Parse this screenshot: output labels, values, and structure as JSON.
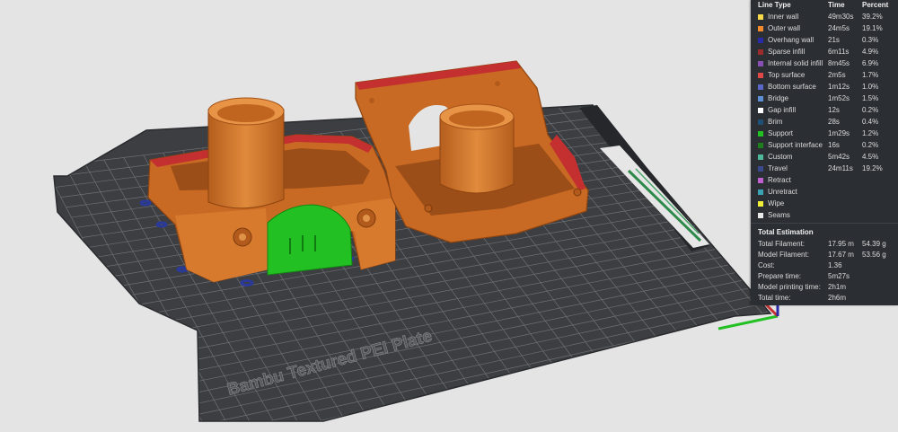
{
  "plate": {
    "label": "Bambu Textured PEI Plate"
  },
  "legend": {
    "headers": {
      "line_type": "Line Type",
      "time": "Time",
      "percent": "Percent"
    },
    "rows": [
      {
        "name": "Inner wall",
        "time": "49m30s",
        "percent": "39.2%",
        "color": "#f7d94a"
      },
      {
        "name": "Outer wall",
        "time": "24m5s",
        "percent": "19.1%",
        "color": "#f08a2c"
      },
      {
        "name": "Overhang wall",
        "time": "21s",
        "percent": "0.3%",
        "color": "#2a2aa8"
      },
      {
        "name": "Sparse infill",
        "time": "6m11s",
        "percent": "4.9%",
        "color": "#9c2b2b"
      },
      {
        "name": "Internal solid infill",
        "time": "8m45s",
        "percent": "6.9%",
        "color": "#8a4fb5"
      },
      {
        "name": "Top surface",
        "time": "2m5s",
        "percent": "1.7%",
        "color": "#e04848"
      },
      {
        "name": "Bottom surface",
        "time": "1m12s",
        "percent": "1.0%",
        "color": "#5a66c8"
      },
      {
        "name": "Bridge",
        "time": "1m52s",
        "percent": "1.5%",
        "color": "#5b8fd6"
      },
      {
        "name": "Gap infill",
        "time": "12s",
        "percent": "0.2%",
        "color": "#ffffff"
      },
      {
        "name": "Brim",
        "time": "28s",
        "percent": "0.4%",
        "color": "#1f4f74"
      },
      {
        "name": "Support",
        "time": "1m29s",
        "percent": "1.2%",
        "color": "#22c022"
      },
      {
        "name": "Support interface",
        "time": "16s",
        "percent": "0.2%",
        "color": "#1e7e1e"
      },
      {
        "name": "Custom",
        "time": "5m42s",
        "percent": "4.5%",
        "color": "#4fb89a"
      },
      {
        "name": "Travel",
        "time": "24m11s",
        "percent": "19.2%",
        "color": "#3a4a8c"
      },
      {
        "name": "Retract",
        "time": "",
        "percent": "",
        "color": "#c060d0"
      },
      {
        "name": "Unretract",
        "time": "",
        "percent": "",
        "color": "#3aa4b4"
      },
      {
        "name": "Wipe",
        "time": "",
        "percent": "",
        "color": "#f0f03a"
      },
      {
        "name": "Seams",
        "time": "",
        "percent": "",
        "color": "#e8e8e8"
      }
    ]
  },
  "estimation": {
    "title": "Total Estimation",
    "rows": [
      {
        "label": "Total Filament:",
        "v1": "17.95 m",
        "v2": "54.39 g"
      },
      {
        "label": "Model Filament:",
        "v1": "17.67 m",
        "v2": "53.56 g"
      },
      {
        "label": "Cost:",
        "v1": "1.36",
        "v2": ""
      },
      {
        "label": "Prepare time:",
        "v1": "5m27s",
        "v2": ""
      },
      {
        "label": "Model printing time:",
        "v1": "2h1m",
        "v2": ""
      },
      {
        "label": "Total time:",
        "v1": "2h6m",
        "v2": ""
      }
    ]
  },
  "colors": {
    "viewport_bg": "#e4e4e4",
    "plate": "#3d3e42",
    "model": "#d9782a",
    "support": "#22c022",
    "panel_bg": "#2b2e33"
  }
}
